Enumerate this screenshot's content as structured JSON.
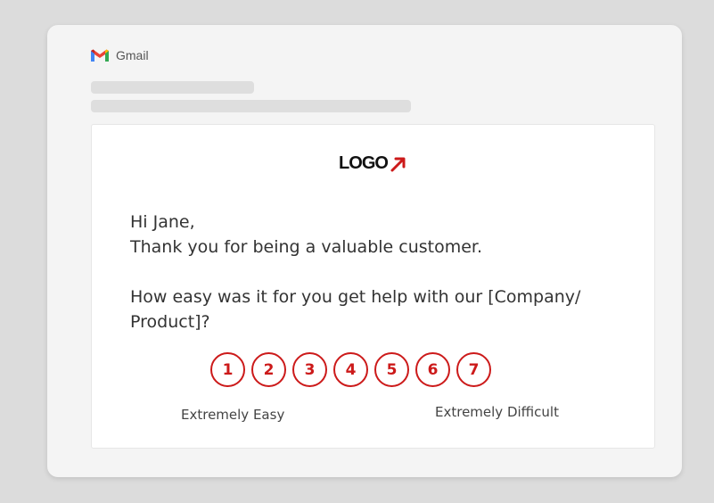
{
  "app": {
    "name": "Gmail"
  },
  "email": {
    "logo_text": "LOGO",
    "greeting_line": "Hi Jane,",
    "thanks_line": "Thank you for being a valuable customer.",
    "question": "How easy was it for you get help with our [Company/ Product]?",
    "scale": [
      "1",
      "2",
      "3",
      "4",
      "5",
      "6",
      "7"
    ],
    "scale_low_label": "Extremely Easy",
    "scale_high_label": "Extremely Difficult"
  },
  "colors": {
    "accent": "#cc1a1a",
    "background": "#dcdcdc",
    "card": "#ffffff"
  }
}
